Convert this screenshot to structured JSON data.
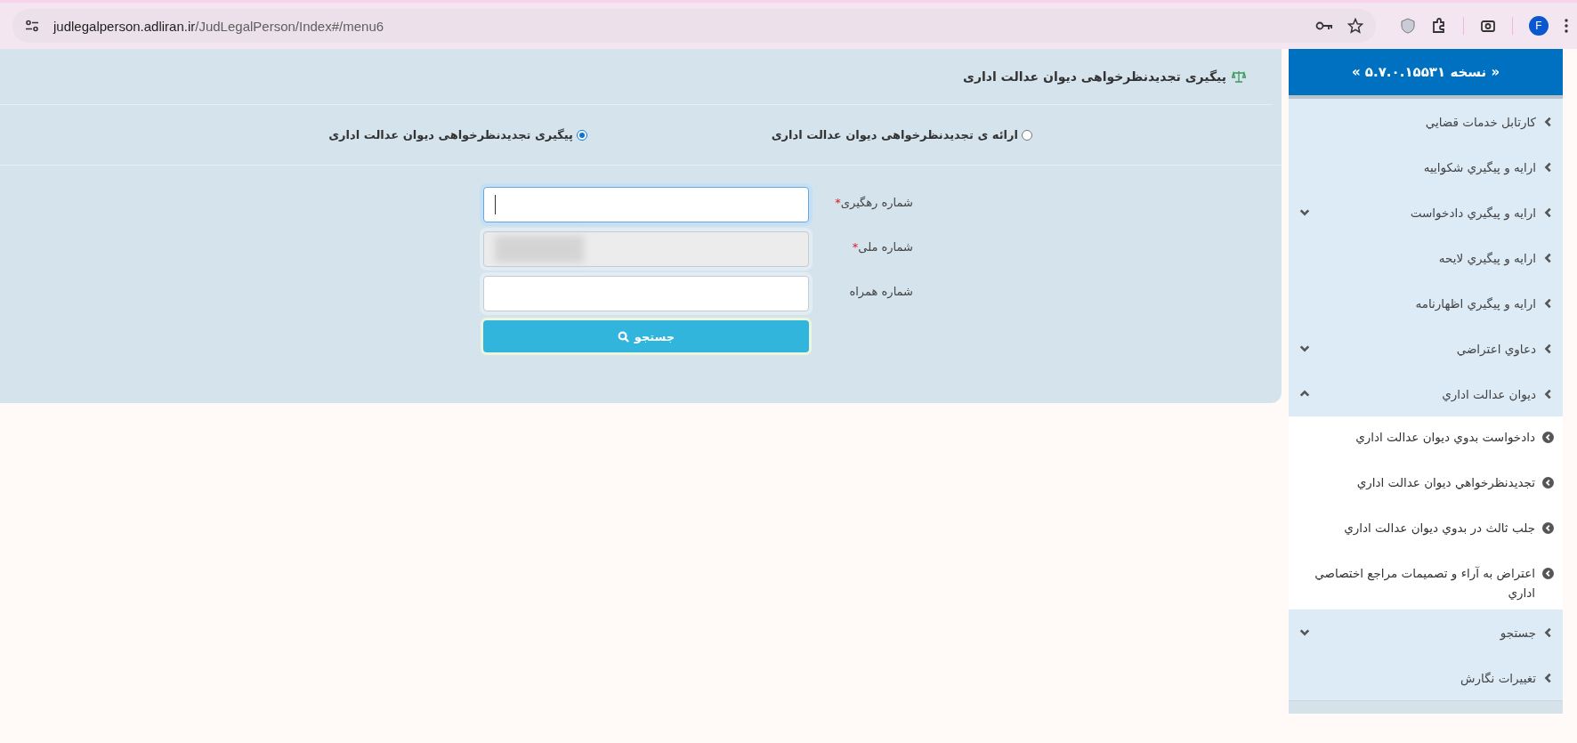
{
  "browser": {
    "url_host": "judlegalperson.adliran.ir",
    "url_path": "/JudLegalPerson/Index#/menu6",
    "avatar": "F"
  },
  "page": {
    "title": "پیگیری تجدیدنظرخواهی دیوان عدالت اداری",
    "options": [
      {
        "label": "ارائه ی تجدیدنظرخواهی دیوان عدالت اداری",
        "selected": false
      },
      {
        "label": "پیگیری تجدیدنظرخواهی دیوان عدالت اداری",
        "selected": true
      }
    ],
    "fields": [
      {
        "label": "شماره رهگیری",
        "required_mark": "*",
        "focused": true,
        "redacted": false
      },
      {
        "label": "شماره ملی",
        "required_mark": "*",
        "focused": false,
        "redacted": true
      },
      {
        "label": "شماره همراه",
        "focused": false,
        "redacted": false
      }
    ],
    "search_button": "جستجو"
  },
  "sidebar": {
    "version": "« نسخه ۵.۷.۰.۱۵۵۳۱ »",
    "items": [
      {
        "label": "کارتابل خدمات قضايي"
      },
      {
        "label": "ارايه و پيگيري شکواييه"
      },
      {
        "label": "ارايه و پيگيري دادخواست",
        "expanded": false
      },
      {
        "label": "ارايه و پيگيري لايحه"
      },
      {
        "label": "ارايه و پيگيري اظهارنامه"
      },
      {
        "label": "دعاوي اعتراضي",
        "expanded": false
      },
      {
        "label": "ديوان عدالت اداري",
        "expanded": true,
        "children": [
          {
            "label": "دادخواست بدوي ديوان عدالت اداري"
          },
          {
            "label": "تجديدنظرخواهي ديوان عدالت اداري"
          },
          {
            "label": "جلب ثالث در بدوي ديوان عدالت اداري"
          },
          {
            "label": "اعتراض به آراء و تصميمات مراجع اختصاصي اداري"
          }
        ]
      },
      {
        "label": "جستجو",
        "expanded": false
      },
      {
        "label": "تغييرات نگارش"
      }
    ]
  }
}
